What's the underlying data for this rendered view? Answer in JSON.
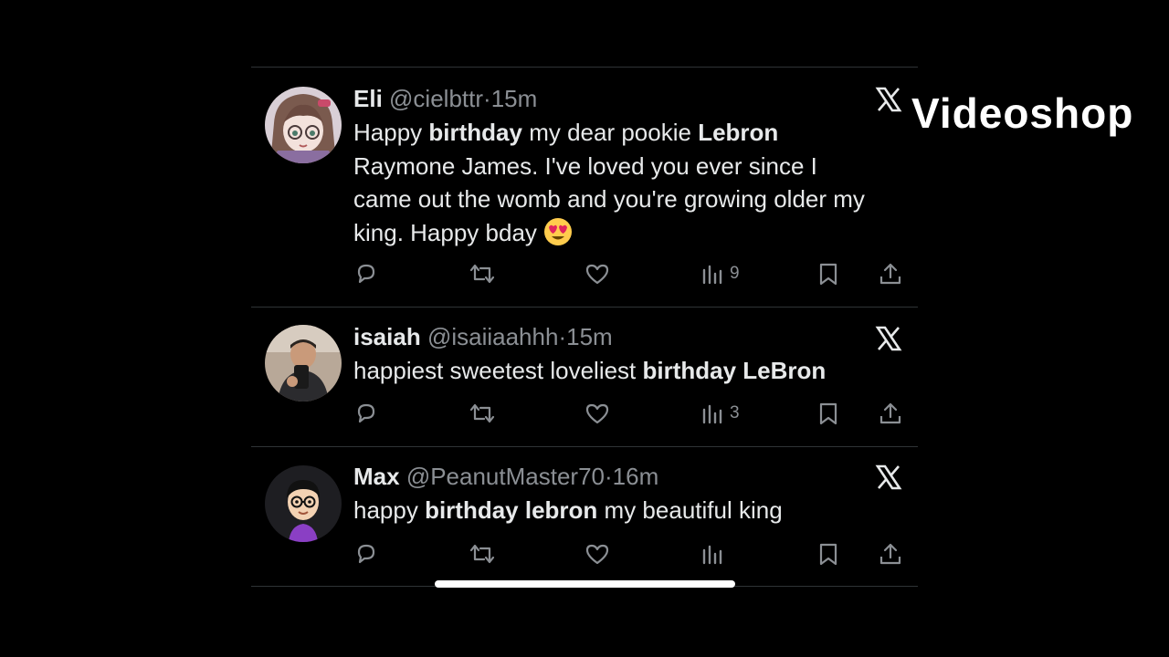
{
  "watermark": "Videoshop",
  "tweets": [
    {
      "display_name": "Eli",
      "handle": "@cielbttr",
      "separator": "·",
      "time": "15m",
      "text_parts": [
        {
          "t": "Happy ",
          "b": false
        },
        {
          "t": "birthday",
          "b": true
        },
        {
          "t": " my dear pookie ",
          "b": false
        },
        {
          "t": "Lebron",
          "b": true
        },
        {
          "t": " Raymone James. I've loved you ever since I came out the womb and you're growing older my king. Happy bday ",
          "b": false
        }
      ],
      "emoji": "heart-eyes-emoji",
      "views": "9",
      "avatar": "anime-girl-avatar"
    },
    {
      "display_name": "isaiah",
      "handle": "@isaiiaahhh",
      "separator": "·",
      "time": "15m",
      "text_parts": [
        {
          "t": "happiest sweetest loveliest ",
          "b": false
        },
        {
          "t": "birthday LeBron",
          "b": true
        }
      ],
      "views": "3",
      "avatar": "selfie-photo-avatar"
    },
    {
      "display_name": "Max",
      "handle": "@PeanutMaster70",
      "separator": "·",
      "time": "16m",
      "text_parts": [
        {
          "t": "happy ",
          "b": false
        },
        {
          "t": "birthday lebron",
          "b": true
        },
        {
          "t": " my beautiful king",
          "b": false
        }
      ],
      "views": "",
      "avatar": "mii-character-avatar"
    }
  ],
  "icons": {
    "reply": "reply-icon",
    "retweet": "retweet-icon",
    "like": "heart-icon",
    "views": "views-chart-icon",
    "bookmark": "bookmark-icon",
    "share": "share-icon",
    "platform": "x-logo-icon"
  },
  "colors": {
    "background": "#000000",
    "text": "#e7e9ea",
    "muted": "#8b8f94",
    "divider": "#2f3336"
  }
}
